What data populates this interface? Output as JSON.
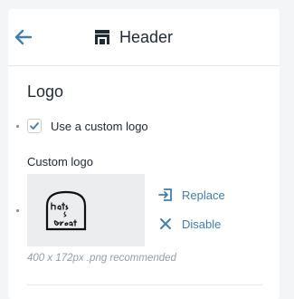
{
  "header": {
    "title": "Header",
    "back_icon": "arrow-left-icon",
    "section_icon": "storefront-header-icon"
  },
  "logo_section": {
    "title": "Logo",
    "use_custom_logo": {
      "label": "Use a custom logo",
      "checked": true
    },
    "custom_logo": {
      "label": "Custom logo",
      "image_text": "Hats & Great",
      "replace_label": "Replace",
      "disable_label": "Disable",
      "hint": "400 x 172px .png recommended"
    }
  },
  "colors": {
    "accent": "#3d7eb4",
    "text": "#212b36",
    "muted": "#919eab",
    "image_bg": "#ebedef"
  }
}
